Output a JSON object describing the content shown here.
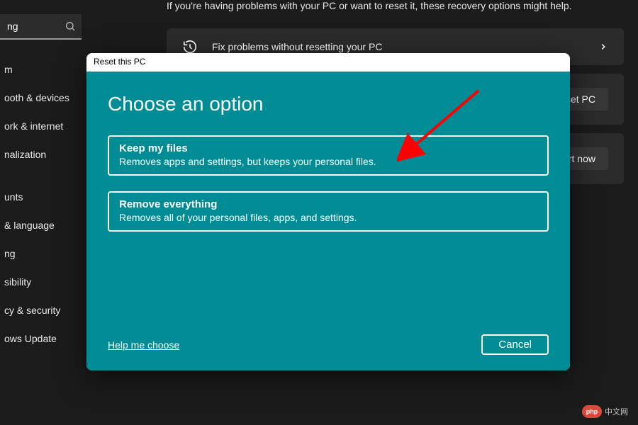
{
  "sidebar": {
    "search_value": "ng",
    "items": [
      {
        "label": "m"
      },
      {
        "label": "ooth & devices"
      },
      {
        "label": "ork & internet"
      },
      {
        "label": "nalization"
      },
      {
        "label": "unts"
      },
      {
        "label": "& language"
      },
      {
        "label": "ng"
      },
      {
        "label": "sibility"
      },
      {
        "label": "cy & security"
      },
      {
        "label": "ows Update"
      }
    ]
  },
  "main": {
    "intro": "If you're having problems with your PC or want to reset it, these recovery options might help.",
    "card1_text": "Fix problems without resetting your PC",
    "card2_button": "eset PC",
    "card3_button": "tart now"
  },
  "dialog": {
    "title": "Reset this PC",
    "heading": "Choose an option",
    "option1": {
      "title": "Keep my files",
      "desc": "Removes apps and settings, but keeps your personal files."
    },
    "option2": {
      "title": "Remove everything",
      "desc": "Removes all of your personal files, apps, and settings."
    },
    "help_link": "Help me choose",
    "cancel": "Cancel"
  },
  "watermark": {
    "badge": "php",
    "text": "中文网"
  },
  "colors": {
    "dialog_teal": "#008c95",
    "arrow_red": "#ff0000",
    "bg_dark": "#1b1b1b",
    "card_bg": "#2b2b2b"
  }
}
